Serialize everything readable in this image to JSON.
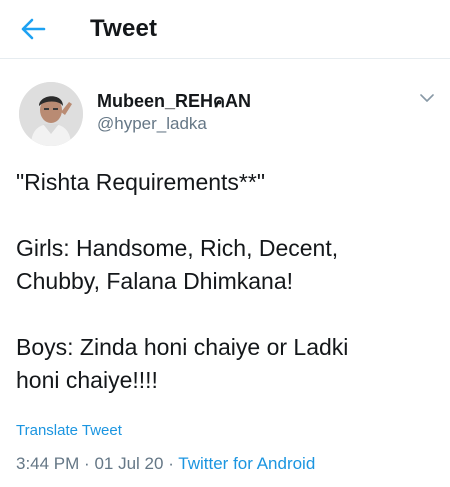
{
  "header": {
    "title": "Tweet",
    "back_icon": "arrow-left-icon",
    "accent_color": "#1da1f2"
  },
  "tweet": {
    "author": {
      "display_name": "Mubeen_REHคAN",
      "handle": "@hyper_ladka"
    },
    "menu_icon": "chevron-down-icon",
    "text_lines": [
      "\"Rishta Requirements**\"",
      "",
      "Girls: Handsome, Rich, Decent,",
      "Chubby, Falana Dhimkana!",
      "",
      "Boys: Zinda honi chaiye or Ladki",
      "honi chaiye!!!!"
    ],
    "translate_label": "Translate Tweet",
    "time": "3:44 PM",
    "separator": "·",
    "date": "01 Jul 20",
    "source": "Twitter for Android"
  }
}
